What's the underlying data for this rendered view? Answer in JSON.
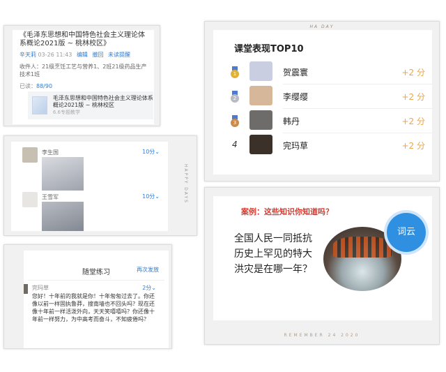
{
  "panel_message": {
    "title": "《毛泽东思想和中国特色社会主义理论体系概论2021版 ~ 桃林校区》",
    "author": "辛天莉",
    "datetime": "03-26 11:43",
    "edit": "编辑",
    "recall": "撤回",
    "unread_reminder": "未读提醒",
    "recipients": "收件人：21级烹饪工艺与营养1、2班21级药品生产技术1班",
    "read_label": "已读：",
    "read_count": "88/90",
    "attachment_title": "毛泽东思想和中国特色社会主义理论体系概论2021版 ~ 桃林校区",
    "attachment_size": "6.6专题教学"
  },
  "panel_students": {
    "side_text": "HAPPY DAYS",
    "items": [
      {
        "name": "李生国",
        "score": "10分⌄"
      },
      {
        "name": "王雪军",
        "score": "10分⌄"
      }
    ]
  },
  "panel_exercise": {
    "title": "随堂练习",
    "resend": "再次发放",
    "student": "完玛草",
    "score": "2分⌄",
    "answer": "您好！十年前的我就是你！十年匆匆过去了。你还像以前一样固执鲁莽，搜南墙也不回头吗？现在还像十年前一样活泼外向，天天笑嘻嘻吗？你还像十年前一样努力，为中高考而奋斗，不知疲倦吗？"
  },
  "panel_top": {
    "deco": "HA DAY",
    "title": "课堂表现TOP10",
    "ranks": [
      {
        "rank": "1",
        "name": "贺震寰",
        "points": "+2 分"
      },
      {
        "rank": "2",
        "name": "李缨缨",
        "points": "+2 分"
      },
      {
        "rank": "3",
        "name": "韩丹",
        "points": "+2 分"
      },
      {
        "rank": "4",
        "name": "完玛草",
        "points": "+2 分"
      }
    ]
  },
  "panel_case": {
    "question": "案例：这些知识你知道吗？",
    "body": "全国人民一同抵抗历史上罕见的特大洪灾是在哪一年？",
    "bubble": "词云",
    "date": "REMEMBER 24 2020"
  },
  "colors": {
    "accent_blue": "#2d7bd6",
    "points_orange": "#e9a64b",
    "question_red": "#d63a2e",
    "bubble_blue": "#2f8fe0"
  }
}
